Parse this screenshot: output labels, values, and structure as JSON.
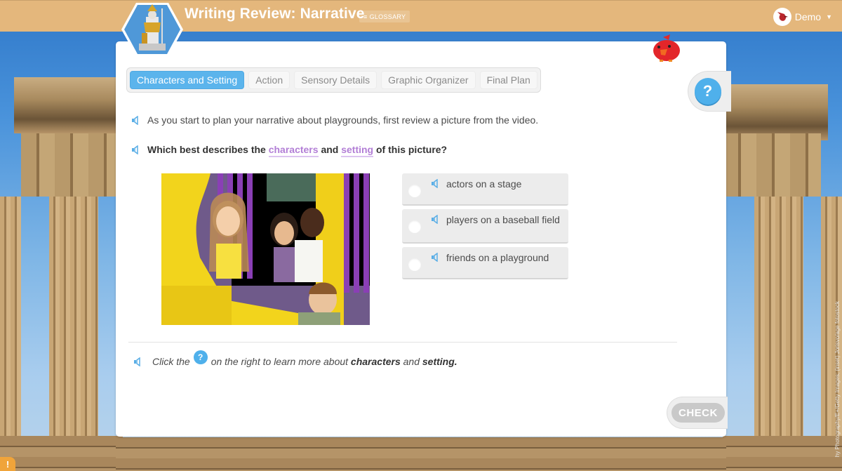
{
  "header": {
    "title": "Writing Review: Narrative",
    "glossary_label": "GLOSSARY",
    "glossary_icon": "hamburger-icon",
    "user_name": "Demo",
    "user_avatar_icon": "cardinal-avatar-icon"
  },
  "tabs": [
    {
      "label": "Characters and Setting",
      "active": true
    },
    {
      "label": "Action",
      "active": false
    },
    {
      "label": "Sensory Details",
      "active": false
    },
    {
      "label": "Graphic Organizer",
      "active": false
    },
    {
      "label": "Final Plan",
      "active": false
    }
  ],
  "help": {
    "label": "?"
  },
  "content": {
    "intro": "As you start to plan your narrative about playgrounds, first review a picture from the video.",
    "question": {
      "prefix": "Which best describes the",
      "term1": "characters",
      "middle": "and",
      "term2": "setting",
      "suffix": "of this picture?"
    },
    "image_alt": "Four smiling children on a yellow playground slide",
    "options": [
      {
        "text": "actors on a stage",
        "selected": false
      },
      {
        "text": "players on a baseball field",
        "selected": false
      },
      {
        "text": "friends on a playground",
        "selected": false
      }
    ],
    "footnote": {
      "prefix": "Click the",
      "help_glyph": "?",
      "middle": "on the right to learn more about",
      "term1": "characters",
      "and": "and",
      "term2": "setting."
    }
  },
  "check_label": "CHECK",
  "credit": "hy Photography/E+/Getty Images; (inset) Jorisvo/age fotostock",
  "colors": {
    "header_bg": "#e4b77c",
    "accent_blue": "#5bb4ec",
    "vocab_purple": "#b27ed6",
    "warning_orange": "#f0a43a"
  }
}
